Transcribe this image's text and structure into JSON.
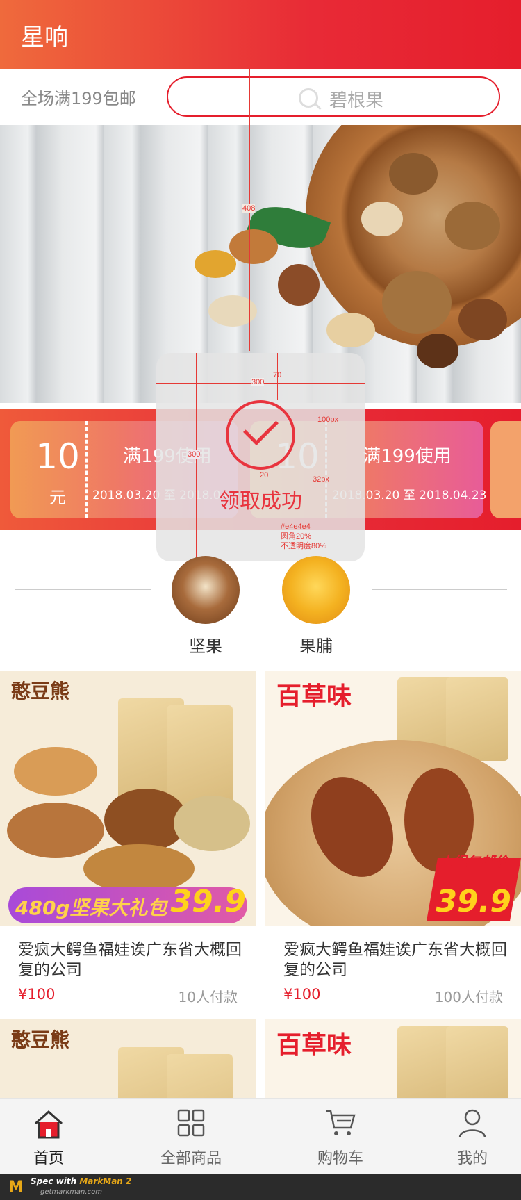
{
  "header": {
    "title": "星响"
  },
  "search": {
    "promo": "全场满199包邮",
    "placeholder": "碧根果"
  },
  "coupons": [
    {
      "amount": "10",
      "unit": "元",
      "condition": "满199使用",
      "dates": "2018.03.20 至 2018.04.23"
    },
    {
      "amount": "10",
      "unit": "元",
      "condition": "满199使用",
      "dates": "2018.03.20 至 2018.04.23"
    }
  ],
  "toast": {
    "message": "领取成功"
  },
  "spec": {
    "height_408": "408",
    "width_300_top": "300",
    "gap_70": "70",
    "size_100": "100px",
    "height_300": "300",
    "gap_20": "20",
    "font_32": "32px",
    "bg_note": "#e4e4e4",
    "radius_note": "圆角20%",
    "opacity_note": "不透明度80%"
  },
  "categories": [
    {
      "label": "坚果"
    },
    {
      "label": "果脯"
    }
  ],
  "products": [
    {
      "name": "爱疯大鳄鱼福娃诶广东省大概回复的公司",
      "price": "¥100",
      "sold": "10人付款",
      "brand": "憨豆熊",
      "promo": "480g坚果大礼包",
      "promo_price": "39.9"
    },
    {
      "name": "爱疯大鳄鱼福娃诶广东省大概回复的公司",
      "price": "¥100",
      "sold": "100人付款",
      "brand": "百草味",
      "promo": "大促包邮价",
      "promo_price": "39.9"
    },
    {
      "brand": "憨豆熊"
    },
    {
      "brand": "百草味"
    }
  ],
  "tabbar": {
    "items": [
      {
        "label": "首页",
        "icon": "home-icon",
        "active": true
      },
      {
        "label": "全部商品",
        "icon": "grid-icon",
        "active": false
      },
      {
        "label": "购物车",
        "icon": "cart-icon",
        "active": false
      },
      {
        "label": "我的",
        "icon": "user-icon",
        "active": false
      }
    ]
  },
  "footer": {
    "spec_with": "Spec with ",
    "brand": "MarkMan 2",
    "url": "getmarkman.com"
  },
  "colors": {
    "brand_red": "#e51e2c",
    "toast_bg": "#e4e4e4"
  }
}
